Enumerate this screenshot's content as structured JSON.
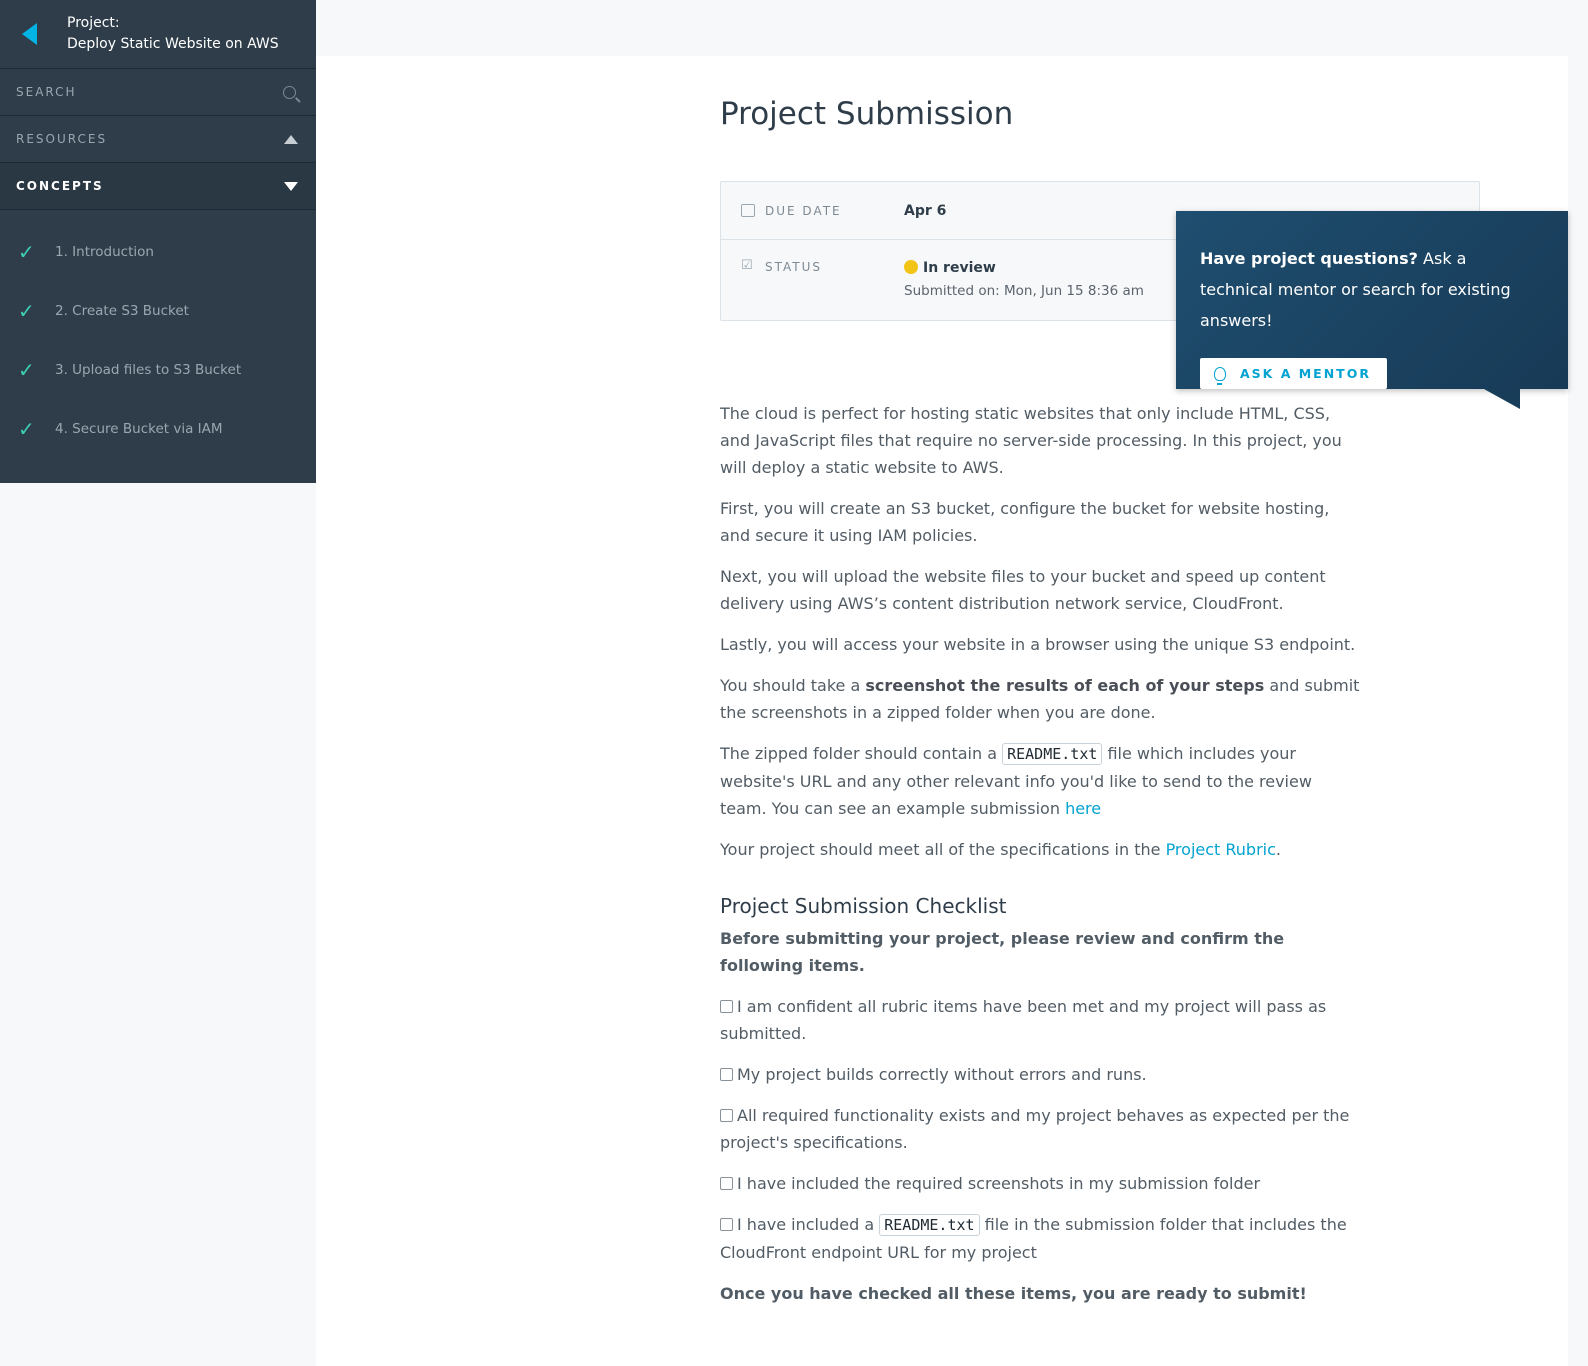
{
  "sidebar": {
    "project_label": "Project:",
    "project_name": "Deploy Static Website on AWS",
    "search_label": "SEARCH",
    "resources_label": "RESOURCES",
    "concepts_label": "CONCEPTS",
    "concepts": [
      {
        "label": "1. Introduction",
        "icon": "check-icon"
      },
      {
        "label": "2. Create S3 Bucket",
        "icon": "check-icon"
      },
      {
        "label": "3. Upload files to S3 Bucket",
        "icon": "check-icon"
      },
      {
        "label": "4. Secure Bucket via IAM",
        "icon": "check-icon"
      }
    ]
  },
  "main": {
    "title": "Project Submission",
    "due": {
      "label": "DUE DATE",
      "value": "Apr 6"
    },
    "status": {
      "label": "STATUS",
      "value": "In review",
      "submitted": "Submitted on: Mon, Jun 15 8:36 am",
      "dot_color": "#f2c416"
    },
    "intro": [
      "The cloud is perfect for hosting static websites that only include HTML, CSS, and JavaScript files that require no server-side processing. In this project, you will deploy a static website to AWS.",
      "First, you will create an S3 bucket, configure the bucket for website hosting, and secure it using IAM policies.",
      "Next, you will upload the website files to your bucket and speed up content delivery using AWS’s content distribution network service, CloudFront.",
      "Lastly, you will access your website in a browser using the unique S3 endpoint."
    ],
    "screenshot_para": {
      "before": "You should take a ",
      "bold": "screenshot the results of each of your steps",
      "after": " and submit the screenshots in a zipped folder when you are done."
    },
    "readme_para": {
      "before": "The zipped folder should contain a ",
      "code": "README.txt",
      "after": " file which includes your website's URL and any other relevant info you'd like to send to the review team. You can see an example submission ",
      "link": "here"
    },
    "rubric_para": {
      "before": "Your project should meet all of the specifications in the ",
      "link": "Project Rubric",
      "after": "."
    },
    "checklist": {
      "title": "Project Submission Checklist",
      "subtitle": "Before submitting your project, please review and confirm the following items.",
      "items": [
        "I am confident all rubric items have been met and my project will pass as submitted.",
        "My project builds correctly without errors and runs.",
        "All required functionality exists and my project behaves as expected per the project's specifications.",
        "I have included the required screenshots in my submission folder"
      ],
      "last_item": {
        "before": "I have included a ",
        "code": "README.txt",
        "after": " file in the submission folder that includes the CloudFront endpoint URL for my project"
      },
      "final": "Once you have checked all these items, you are ready to submit!"
    }
  },
  "mentor": {
    "bold": "Have project questions?",
    "text": " Ask a technical mentor or search for existing answers!",
    "button": "ASK A MENTOR"
  },
  "colors": {
    "sidebar_bg": "#2e3d49",
    "accent": "#02b3e4",
    "link": "#02a3d1",
    "check": "#3dcfb6",
    "mentor_bg": "#1d4a6b"
  }
}
